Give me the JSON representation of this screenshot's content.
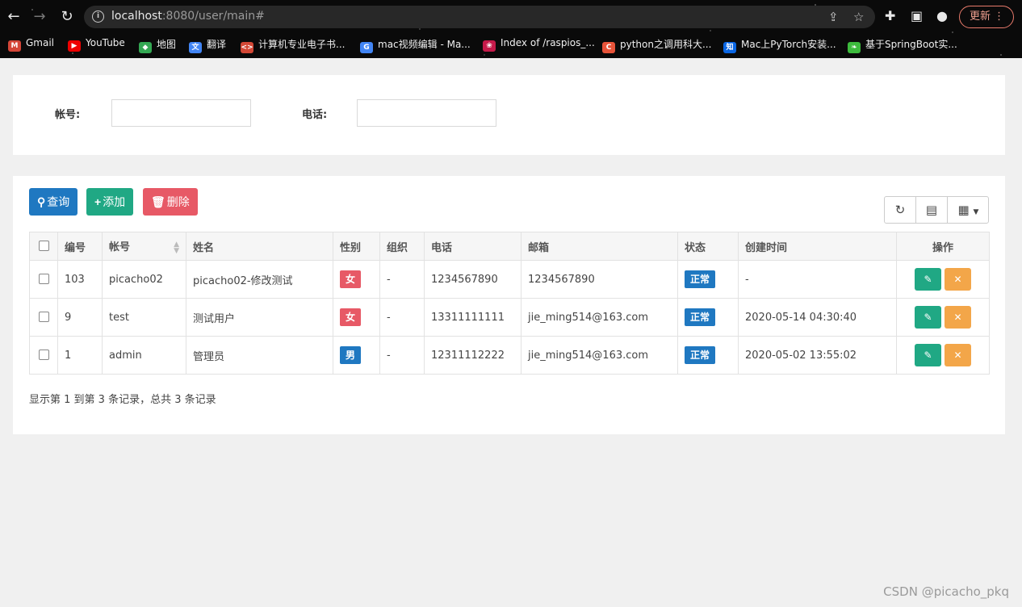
{
  "browser": {
    "url_host": "localhost",
    "url_rest": ":8080/user/main#",
    "update_label": "更新",
    "bookmarks": [
      {
        "label": "Gmail",
        "color": "#d44638",
        "glyph": "M"
      },
      {
        "label": "YouTube",
        "color": "#e00",
        "glyph": "▶"
      },
      {
        "label": "地图",
        "color": "#34a853",
        "glyph": "◆"
      },
      {
        "label": "翻译",
        "color": "#4285f4",
        "glyph": "文"
      },
      {
        "label": "计算机专业电子书...",
        "color": "#d34836",
        "glyph": "<>"
      },
      {
        "label": "mac视频编辑 - Ma...",
        "color": "#4285f4",
        "glyph": "G"
      },
      {
        "label": "Index of /raspios_...",
        "color": "#c51a4a",
        "glyph": "❀"
      },
      {
        "label": "python之调用科大...",
        "color": "#e8543a",
        "glyph": "C"
      },
      {
        "label": "Mac上PyTorch安装...",
        "color": "#0a66e4",
        "glyph": "知"
      },
      {
        "label": "基于SpringBoot实...",
        "color": "#3dbb3d",
        "glyph": "❧"
      }
    ]
  },
  "search": {
    "account_label": "帐号:",
    "phone_label": "电话:",
    "account_value": "",
    "phone_value": ""
  },
  "toolbar": {
    "query_label": "查询",
    "add_label": "添加",
    "delete_label": "删除"
  },
  "table": {
    "headers": {
      "id": "编号",
      "account": "帐号",
      "name": "姓名",
      "gender": "性别",
      "org": "组织",
      "phone": "电话",
      "email": "邮箱",
      "status": "状态",
      "created": "创建时间",
      "actions": "操作"
    },
    "rows": [
      {
        "id": "103",
        "account": "picacho02",
        "name": "picacho02-修改测试",
        "gender": "女",
        "org": "-",
        "phone": "1234567890",
        "email": "1234567890",
        "status": "正常",
        "created": "-"
      },
      {
        "id": "9",
        "account": "test",
        "name": "测试用户",
        "gender": "女",
        "org": "-",
        "phone": "13311111111",
        "email": "jie_ming514@163.com",
        "status": "正常",
        "created": "2020-05-14 04:30:40"
      },
      {
        "id": "1",
        "account": "admin",
        "name": "管理员",
        "gender": "男",
        "org": "-",
        "phone": "12311112222",
        "email": "jie_ming514@163.com",
        "status": "正常",
        "created": "2020-05-02 13:55:02"
      }
    ]
  },
  "pager": {
    "summary": "显示第 1 到第 3 条记录，总共 3 条记录"
  },
  "watermark": "CSDN @picacho_pkq",
  "colors": {
    "primary": "#1f78c1",
    "success": "#20a884",
    "danger": "#e75966",
    "warning": "#f3a649"
  }
}
